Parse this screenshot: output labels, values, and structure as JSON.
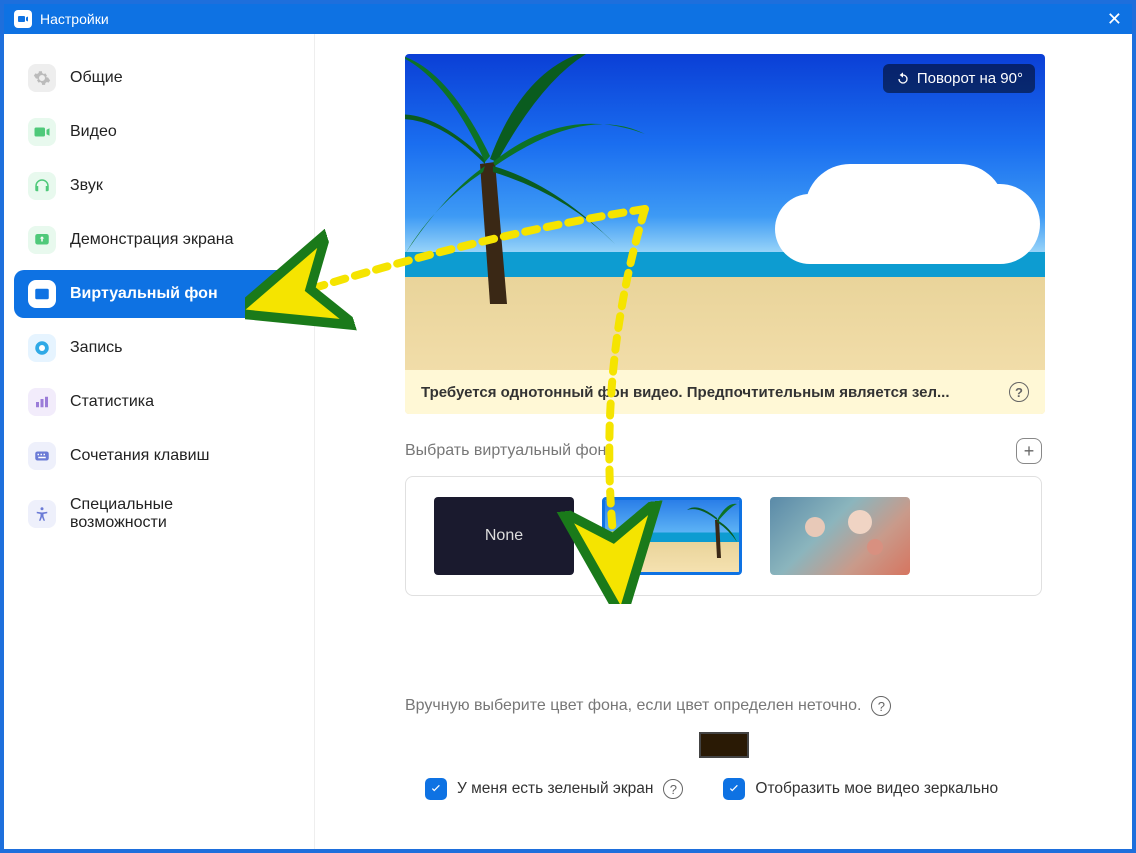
{
  "window": {
    "title": "Настройки"
  },
  "sidebar": {
    "items": [
      {
        "label": "Общие"
      },
      {
        "label": "Видео"
      },
      {
        "label": "Звук"
      },
      {
        "label": "Демонстрация экрана"
      },
      {
        "label": "Виртуальный фон"
      },
      {
        "label": "Запись"
      },
      {
        "label": "Статистика"
      },
      {
        "label": "Сочетания клавиш"
      },
      {
        "label": "Специальные возможности"
      }
    ]
  },
  "preview": {
    "rotate_label": "Поворот на 90°",
    "warning_text": "Требуется однотонный фон видео. Предпочтительным является зел..."
  },
  "backgrounds": {
    "section_title": "Выбрать виртуальный фон",
    "none_label": "None"
  },
  "color_pick": {
    "label": "Вручную выберите цвет фона, если цвет определен неточно.",
    "swatch_color": "#2a1a05"
  },
  "checkboxes": {
    "green_screen": "У меня есть зеленый экран",
    "mirror": "Отобразить мое видео зеркально"
  }
}
